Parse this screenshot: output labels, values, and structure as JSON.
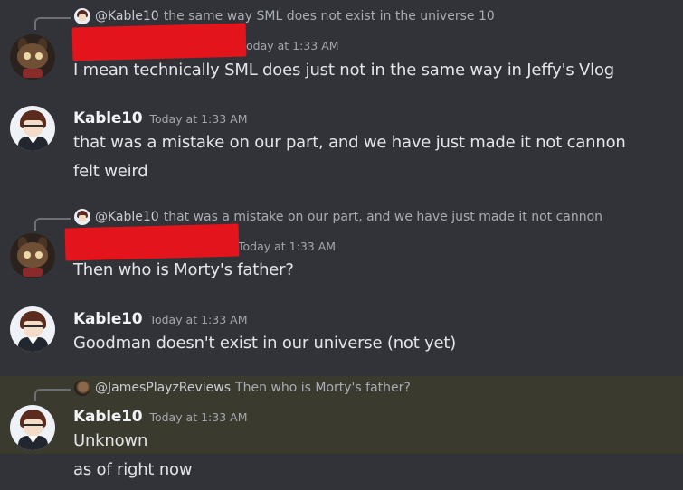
{
  "messages": [
    {
      "reply": {
        "author": "@Kable10",
        "text": "the same way SML does not exist in the universe 10"
      },
      "timestamp": "oday at 1:33 AM",
      "lines": [
        "I mean technically SML does just not in the same way in Jeffy's Vlog"
      ]
    },
    {
      "author": "Kable10",
      "timestamp": "Today at 1:33 AM",
      "lines": [
        "that was a mistake on our part, and we have just made it not cannon",
        "felt weird"
      ]
    },
    {
      "reply": {
        "author": "@Kable10",
        "text": "that was a mistake on our part, and we have just made it not cannon"
      },
      "timestamp": "Today at 1:33 AM",
      "lines": [
        "Then who is Morty's father?"
      ]
    },
    {
      "author": "Kable10",
      "timestamp": "Today at 1:33 AM",
      "lines": [
        "Goodman doesn't exist in our universe (not yet)"
      ]
    },
    {
      "reply": {
        "author": "@JamesPlayzReviews",
        "text": "Then who is Morty's father?"
      },
      "author": "Kable10",
      "timestamp": "Today at 1:33 AM",
      "lines": [
        "Unknown",
        "as of right now"
      ]
    }
  ],
  "colors": {
    "background": "#313338",
    "highlight": "#3b3a2e",
    "redaction": "#e3141b",
    "author": "#f2f3f5",
    "text": "#e3e5e8",
    "muted": "#a3a6ad"
  }
}
